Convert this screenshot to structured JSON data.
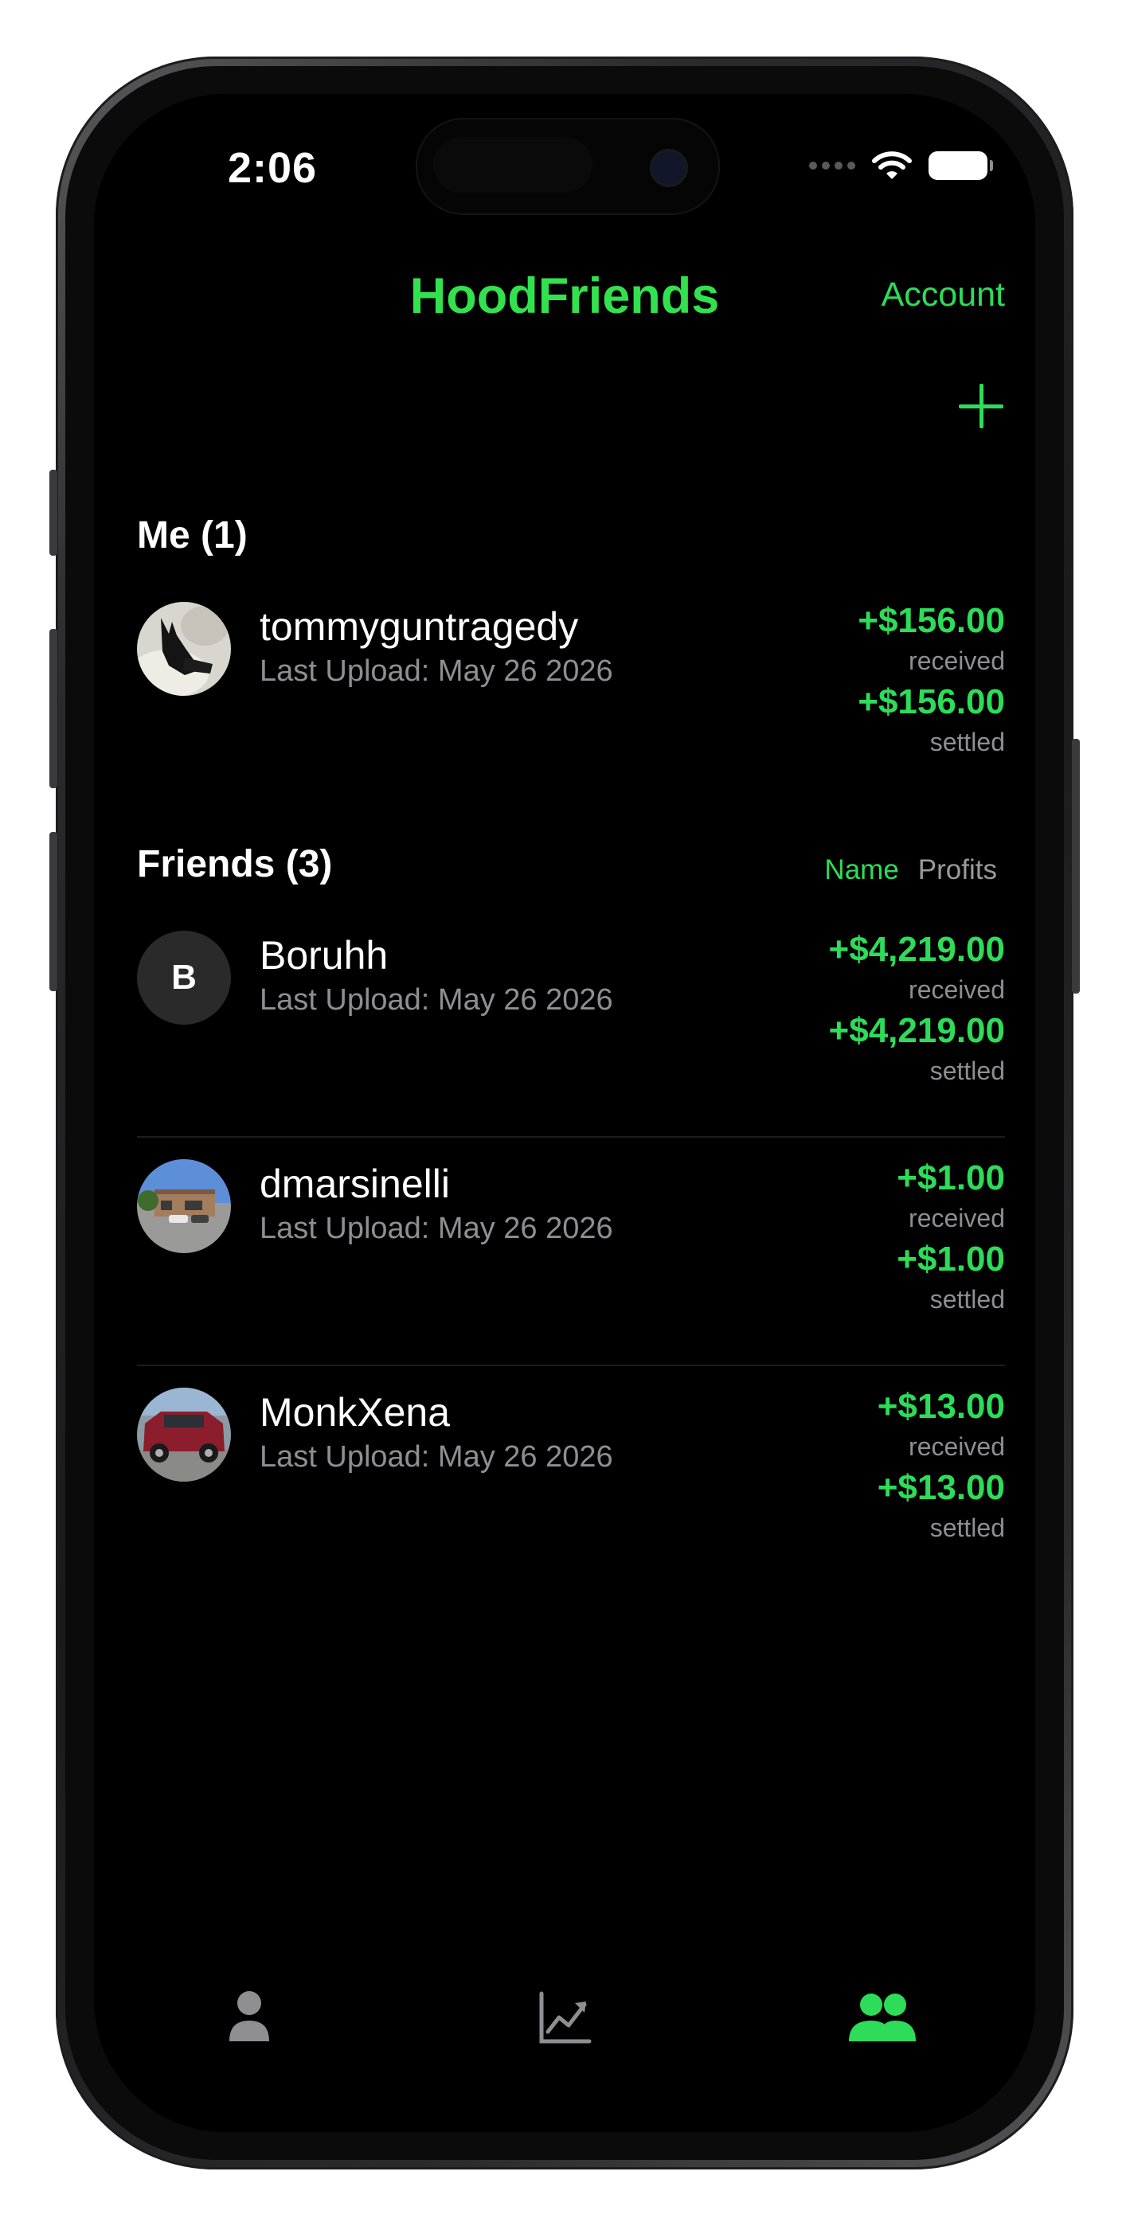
{
  "status_bar": {
    "time": "2:06"
  },
  "header": {
    "title": "HoodFriends",
    "account_label": "Account"
  },
  "me_section": {
    "title": "Me (1)",
    "user": {
      "username": "tommyguntragedy",
      "last_upload": "Last Upload: May 26 2026",
      "received_amount": "+$156.00",
      "received_label": "received",
      "settled_amount": "+$156.00",
      "settled_label": "settled"
    }
  },
  "friends_section": {
    "title": "Friends (3)",
    "sort_name_label": "Name",
    "sort_profits_label": "Profits",
    "friends": [
      {
        "avatar_initial": "B",
        "username": "Boruhh",
        "last_upload": "Last Upload: May 26 2026",
        "received_amount": "+$4,219.00",
        "received_label": "received",
        "settled_amount": "+$4,219.00",
        "settled_label": "settled"
      },
      {
        "username": "dmarsinelli",
        "last_upload": "Last Upload: May 26 2026",
        "received_amount": "+$1.00",
        "received_label": "received",
        "settled_amount": "+$1.00",
        "settled_label": "settled"
      },
      {
        "username": "MonkXena",
        "last_upload": "Last Upload: May 26 2026",
        "received_amount": "+$13.00",
        "received_label": "received",
        "settled_amount": "+$13.00",
        "settled_label": "settled"
      }
    ]
  },
  "tab_bar": {
    "tabs": [
      {
        "icon": "person-icon",
        "active": false
      },
      {
        "icon": "chart-line-icon",
        "active": false
      },
      {
        "icon": "friends-icon",
        "active": true
      }
    ]
  },
  "colors": {
    "accent": "#2ddc58",
    "title": "#32e14e",
    "background": "#000000",
    "secondary_text": "#8e8e93"
  }
}
